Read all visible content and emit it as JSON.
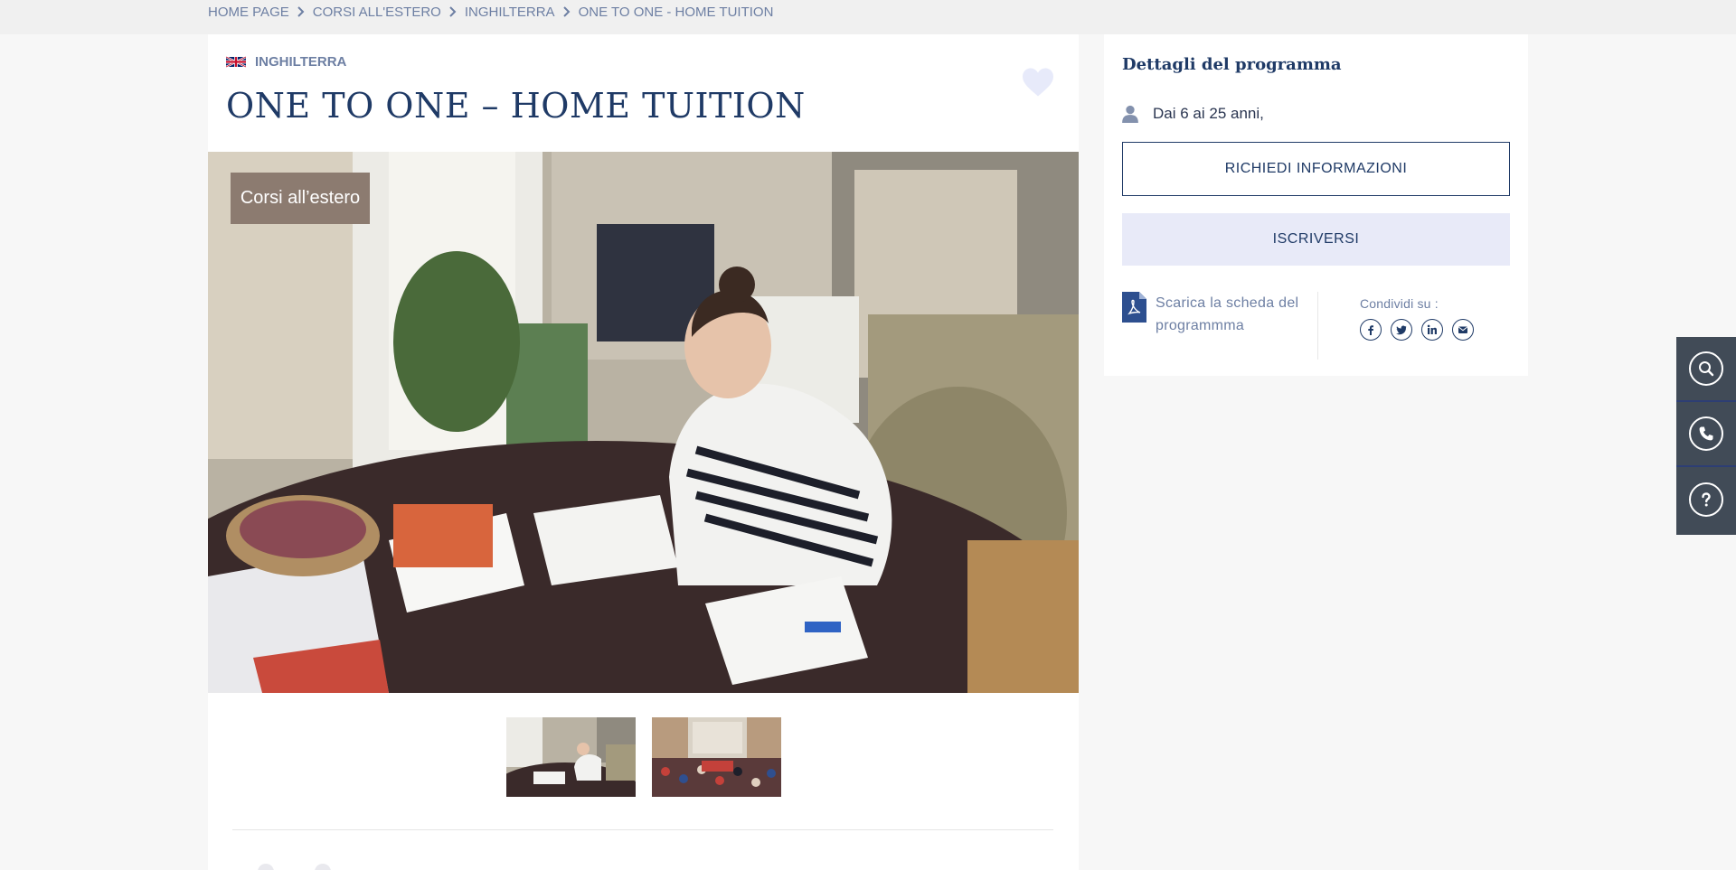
{
  "breadcrumb": {
    "items": [
      "HOME PAGE",
      "CORSI ALL'ESTERO",
      "INGHILTERRA",
      "ONE TO ONE - HOME TUITION"
    ]
  },
  "header": {
    "country": "INGHILTERRA",
    "title": "ONE TO ONE – HOME TUITION"
  },
  "hero": {
    "tag": "Corsi all’estero"
  },
  "sidebar": {
    "title": "Dettagli del programma",
    "age": "Dai 6 ai 25 anni,",
    "request_info_label": "RICHIEDI INFORMAZIONI",
    "enroll_label": "ISCRIVERSI",
    "download_label": "Scarica la scheda del programmma",
    "share_label": "Condividi su :"
  },
  "colors": {
    "primary": "#1f3a66",
    "muted": "#6d7fa3",
    "tag_bg": "#8c7b70",
    "enroll_bg": "#e8eaf8",
    "float_bar": "#414b57"
  },
  "icons": [
    "uk-flag-icon",
    "heart-icon",
    "user-icon",
    "pdf-icon",
    "facebook-icon",
    "twitter-icon",
    "linkedin-icon",
    "email-icon",
    "search-icon",
    "phone-icon",
    "help-icon"
  ]
}
